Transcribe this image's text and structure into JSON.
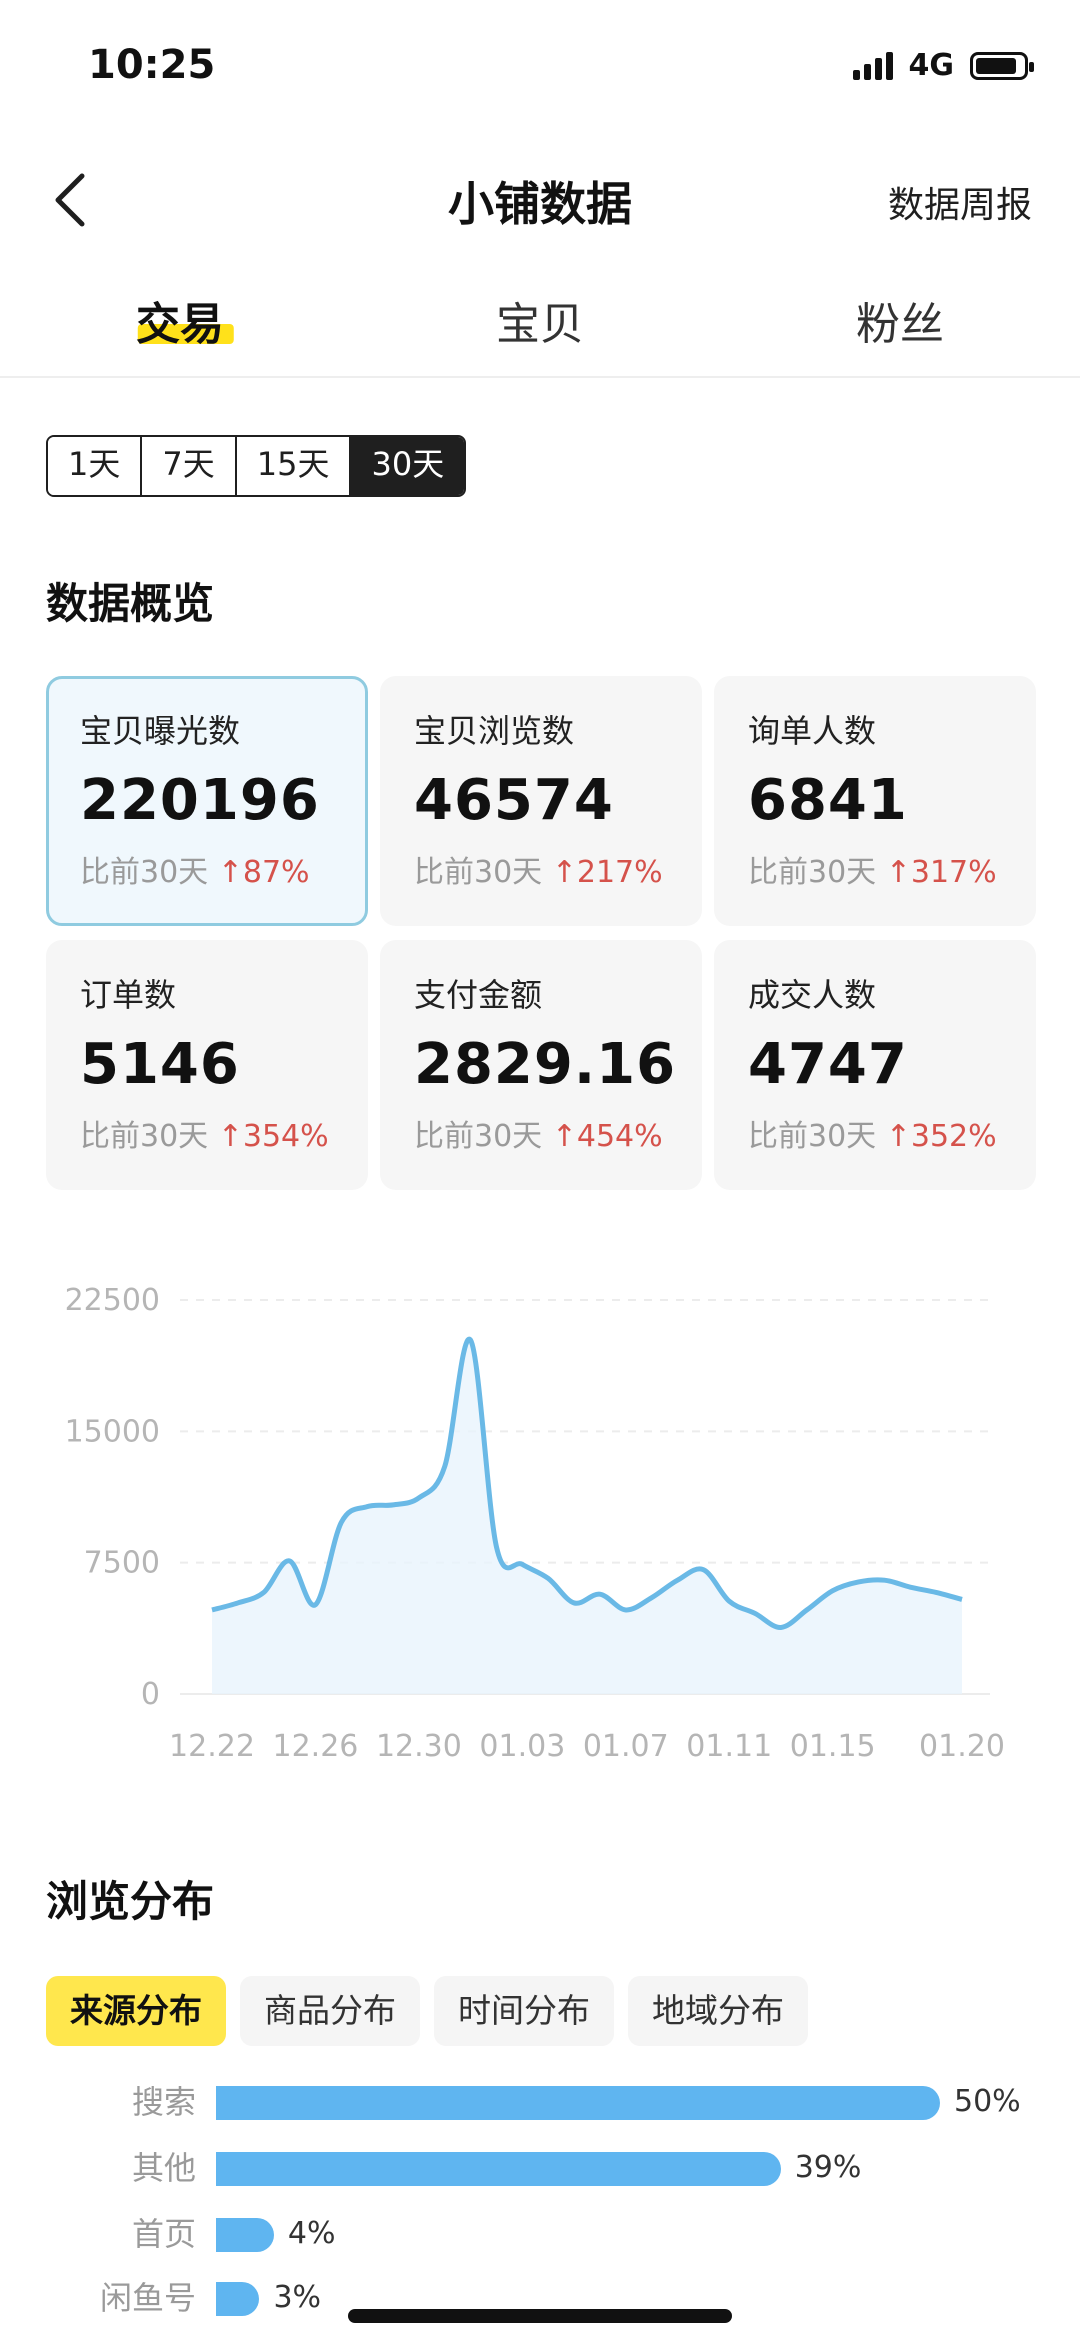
{
  "status": {
    "time": "10:25",
    "network": "4G"
  },
  "nav": {
    "title": "小铺数据",
    "weekly_report": "数据周报"
  },
  "main_tabs": [
    {
      "label": "交易",
      "active": true
    },
    {
      "label": "宝贝",
      "active": false
    },
    {
      "label": "粉丝",
      "active": false
    }
  ],
  "range": {
    "options": [
      "1天",
      "7天",
      "15天",
      "30天"
    ],
    "selected": "30天"
  },
  "overview": {
    "title": "数据概览",
    "cards": [
      {
        "label": "宝贝曝光数",
        "value": "220196",
        "compare_prefix": "比前30天",
        "change": "87%"
      },
      {
        "label": "宝贝浏览数",
        "value": "46574",
        "compare_prefix": "比前30天",
        "change": "217%"
      },
      {
        "label": "询单人数",
        "value": "6841",
        "compare_prefix": "比前30天",
        "change": "317%"
      },
      {
        "label": "订单数",
        "value": "5146",
        "compare_prefix": "比前30天",
        "change": "354%"
      },
      {
        "label": "支付金额",
        "value": "2829.16",
        "compare_prefix": "比前30天",
        "change": "454%"
      },
      {
        "label": "成交人数",
        "value": "4747",
        "compare_prefix": "比前30天",
        "change": "352%"
      }
    ]
  },
  "chart_data": {
    "type": "area",
    "x": [
      "12.22",
      "12.23",
      "12.24",
      "12.25",
      "12.26",
      "12.27",
      "12.28",
      "12.29",
      "12.30",
      "12.31",
      "01.01",
      "01.02",
      "01.03",
      "01.04",
      "01.05",
      "01.06",
      "01.07",
      "01.08",
      "01.09",
      "01.10",
      "01.11",
      "01.12",
      "01.13",
      "01.14",
      "01.15",
      "01.16",
      "01.17",
      "01.18",
      "01.19",
      "01.20"
    ],
    "x_tick_labels": [
      "12.22",
      "12.26",
      "12.30",
      "01.03",
      "01.07",
      "01.11",
      "01.15",
      "01.20"
    ],
    "y": [
      4800,
      5200,
      5800,
      7600,
      5100,
      9800,
      10700,
      10800,
      11200,
      13000,
      20200,
      8400,
      7400,
      6600,
      5200,
      5700,
      4800,
      5500,
      6500,
      7100,
      5300,
      4600,
      3800,
      4800,
      5900,
      6400,
      6500,
      6100,
      5800,
      5400
    ],
    "ylim": [
      0,
      22500
    ],
    "y_ticks": [
      "0",
      "7500",
      "15000",
      "22500"
    ],
    "grid": true,
    "color": "#6ab9e6"
  },
  "browse": {
    "title": "浏览分布",
    "tabs": [
      {
        "label": "来源分布",
        "active": true
      },
      {
        "label": "商品分布",
        "active": false
      },
      {
        "label": "时间分布",
        "active": false
      },
      {
        "label": "地域分布",
        "active": false
      }
    ],
    "bars": [
      {
        "label": "搜索",
        "percent": 50,
        "text": "50%"
      },
      {
        "label": "其他",
        "percent": 39,
        "text": "39%"
      },
      {
        "label": "首页",
        "percent": 4,
        "text": "4%"
      },
      {
        "label": "闲鱼号",
        "percent": 3,
        "text": "3%"
      }
    ]
  }
}
